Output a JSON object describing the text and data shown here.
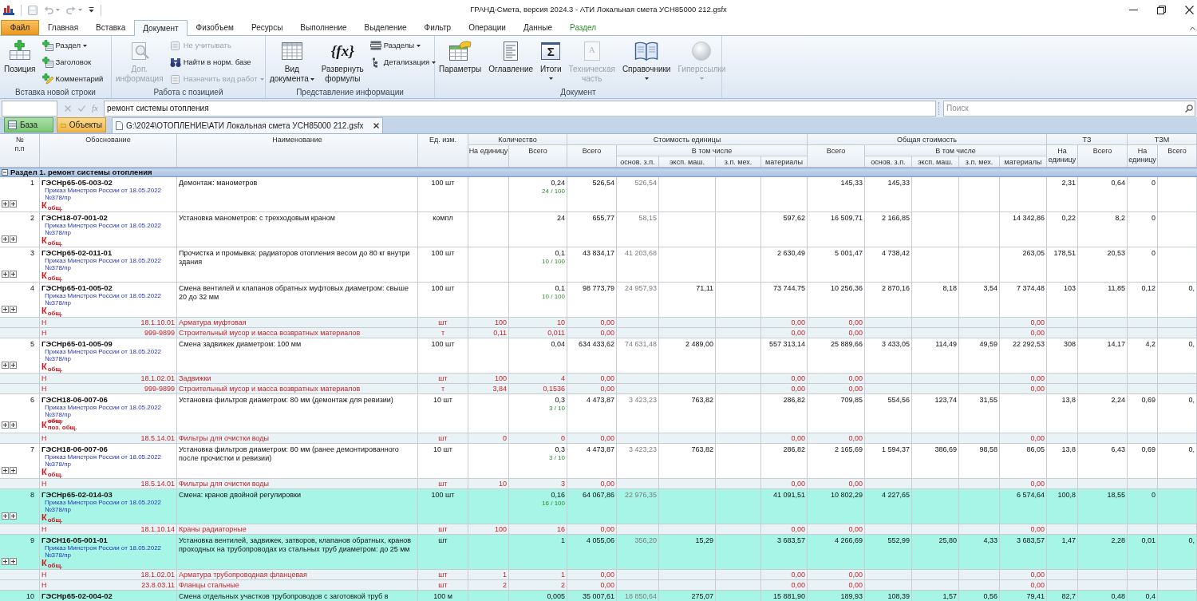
{
  "window": {
    "title": "ГРАНД-Смета, версия 2024.3 - АТИ Локальная смета УСН85000 212.gsfx"
  },
  "quick_access": [
    {
      "kind": "save",
      "disabled": true
    },
    {
      "kind": "undo",
      "disabled": true
    },
    {
      "kind": "redo",
      "disabled": true
    }
  ],
  "ribbon": {
    "tabs": [
      {
        "label": "Файл",
        "kind": "file",
        "selected": false
      },
      {
        "label": "Главная",
        "kind": "plain",
        "selected": false
      },
      {
        "label": "Вставка",
        "kind": "plain",
        "selected": false
      },
      {
        "label": "Документ",
        "kind": "plain",
        "selected": true
      },
      {
        "label": "Физобъем",
        "kind": "plain",
        "selected": false
      },
      {
        "label": "Ресурсы",
        "kind": "plain",
        "selected": false
      },
      {
        "label": "Выполнение",
        "kind": "plain",
        "selected": false
      },
      {
        "label": "Выделение",
        "kind": "plain",
        "selected": false
      },
      {
        "label": "Фильтр",
        "kind": "plain",
        "selected": false
      },
      {
        "label": "Операции",
        "kind": "plain",
        "selected": false
      },
      {
        "label": "Данные",
        "kind": "plain",
        "selected": false
      },
      {
        "label": "Раздел",
        "kind": "context",
        "selected": false
      }
    ],
    "groups": [
      {
        "label": "Вставка новой строки",
        "items": [
          {
            "kind": "large",
            "label": "Позиция",
            "disabled": false,
            "dropdown": false
          },
          {
            "kind": "small",
            "label": "Раздел",
            "disabled": false,
            "dropdown": true
          },
          {
            "kind": "small",
            "label": "Заголовок",
            "disabled": false,
            "dropdown": false
          },
          {
            "kind": "small",
            "label": "Комментарий",
            "disabled": false,
            "dropdown": false
          }
        ]
      },
      {
        "label": "Работа с позицией",
        "items": [
          {
            "kind": "large",
            "label": "Доп. информация",
            "disabled": true,
            "dropdown": false
          },
          {
            "kind": "small",
            "label": "Не учитывать",
            "disabled": true,
            "dropdown": false
          },
          {
            "kind": "small",
            "label": "Найти в норм. базе",
            "disabled": false,
            "dropdown": false
          },
          {
            "kind": "small",
            "label": "Назначить вид работ",
            "disabled": true,
            "dropdown": true
          }
        ]
      },
      {
        "label": "Представление информации",
        "items": [
          {
            "kind": "large",
            "label": "Вид документа",
            "disabled": false,
            "dropdown": true
          },
          {
            "kind": "large",
            "label": "Развернуть формулы",
            "disabled": false,
            "dropdown": false,
            "icon_text": "{fx}"
          },
          {
            "kind": "small",
            "label": "Разделы",
            "disabled": false,
            "dropdown": true
          },
          {
            "kind": "small",
            "label": "Детализация",
            "disabled": false,
            "dropdown": true
          }
        ]
      },
      {
        "label": "Документ",
        "items": [
          {
            "kind": "large",
            "label": "Параметры",
            "disabled": false,
            "dropdown": false
          },
          {
            "kind": "large",
            "label": "Оглавление",
            "disabled": false,
            "dropdown": false
          },
          {
            "kind": "large",
            "label": "Итоги",
            "disabled": false,
            "dropdown": true,
            "icon_text": "Σ"
          },
          {
            "kind": "large",
            "label": "Техническая часть",
            "disabled": true,
            "dropdown": false,
            "icon_text": "A"
          },
          {
            "kind": "large",
            "label": "Справочники",
            "disabled": false,
            "dropdown": true
          },
          {
            "kind": "large",
            "label": "Гиперссылки",
            "disabled": true,
            "dropdown": true
          }
        ]
      }
    ]
  },
  "formula_bar": {
    "function_label": "fx",
    "value": "ремонт системы отопления",
    "search": {
      "placeholder": "Поиск"
    }
  },
  "panels": [
    {
      "label": "База",
      "kind": "base"
    },
    {
      "label": "Объекты",
      "kind": "objects"
    }
  ],
  "documents": [
    {
      "label": "G:\\2024\\ОТОПЛЕНИЕ\\АТИ Локальная смета УСН85000 212.gsfx",
      "selected": true
    }
  ],
  "table": {
    "columns": [
      {
        "label": "№ п.п"
      },
      {
        "label": "Обоснование"
      },
      {
        "label": "Наименование"
      },
      {
        "label": "Ед. изм."
      },
      {
        "label": "Количество",
        "children": [
          {
            "label": "На единицу"
          },
          {
            "label": "Всего"
          }
        ]
      },
      {
        "label": "Стоимость единицы",
        "children": [
          {
            "label": "Всего"
          },
          {
            "label": "В том числе",
            "children": [
              {
                "label": "основ. з.п."
              },
              {
                "label": "эксп. маш."
              },
              {
                "label": "з.п. мех."
              },
              {
                "label": "материалы"
              }
            ]
          }
        ]
      },
      {
        "label": "Общая стоимость",
        "children": [
          {
            "label": "Всего"
          },
          {
            "label": "В том числе",
            "children": [
              {
                "label": "основ. з.п."
              },
              {
                "label": "эксп. маш."
              },
              {
                "label": "з.п. мех."
              },
              {
                "label": "материалы"
              }
            ]
          }
        ]
      },
      {
        "label": "ТЗ",
        "children": [
          {
            "label": "На единицу"
          },
          {
            "label": "Всего"
          }
        ]
      },
      {
        "label": "ТЗМ",
        "children": [
          {
            "label": "На единицу"
          },
          {
            "label": "Всего"
          }
        ]
      }
    ],
    "section": {
      "label": "Раздел 1. ремонт системы отопления",
      "expanded": true
    },
    "rows": [
      {
        "kind": "position",
        "selected": false,
        "number": "1",
        "code": "ГЭСНр65-05-003-02",
        "order": "Приказ Минстроя России от 18.05.2022",
        "order_number": "№378/пр",
        "coef": {
          "letter": "К",
          "labels": [
            {
              "text": "общ.",
              "struck": false
            }
          ]
        },
        "name": "Демонтаж: манометров",
        "unit": "100 шт",
        "qty_formula": "24 / 100",
        "values": {
          "qty_total": "0,24",
          "unit_cost": "526,54",
          "unit_base_wage": "526,54",
          "total_cost": "145,33",
          "total_base_wage": "145,33",
          "labor_per_unit": "2,31",
          "labor_total": "0,64",
          "machine_labor_per_unit": "0"
        }
      },
      {
        "kind": "position",
        "selected": false,
        "number": "2",
        "code": "ГЭСН18-07-001-02",
        "order": "Приказ Минстроя России от 18.05.2022",
        "order_number": "№378/пр",
        "coef": {
          "letter": "К",
          "labels": [
            {
              "text": "общ.",
              "struck": false
            }
          ]
        },
        "name": "Установка манометров: с трехходовым краном",
        "unit": "компл",
        "values": {
          "qty_total": "24",
          "unit_cost": "655,77",
          "unit_base_wage": "58,15",
          "unit_materials": "597,62",
          "total_cost": "16 509,71",
          "total_base_wage": "2 166,85",
          "total_materials": "14 342,86",
          "labor_per_unit": "0,22",
          "labor_total": "8,2",
          "machine_labor_per_unit": "0"
        }
      },
      {
        "kind": "position",
        "selected": false,
        "number": "3",
        "code": "ГЭСНр65-02-011-01",
        "order": "Приказ Минстроя России от 18.05.2022",
        "order_number": "№378/пр",
        "coef": {
          "letter": "К",
          "labels": [
            {
              "text": "общ.",
              "struck": false
            }
          ]
        },
        "name": "Прочистка и промывка: радиаторов отопления весом до 80 кг внутри здания",
        "unit": "100 шт",
        "qty_formula": "10 / 100",
        "values": {
          "qty_total": "0,1",
          "unit_cost": "43 834,17",
          "unit_base_wage": "41 203,68",
          "unit_materials": "2 630,49",
          "total_cost": "5 001,47",
          "total_base_wage": "4 738,42",
          "total_materials": "263,05",
          "labor_per_unit": "178,51",
          "labor_total": "20,53",
          "machine_labor_per_unit": "0"
        }
      },
      {
        "kind": "position",
        "selected": false,
        "number": "4",
        "code": "ГЭСНр65-01-005-02",
        "order": "Приказ Минстроя России от 18.05.2022",
        "order_number": "№378/пр",
        "coef": {
          "letter": "К",
          "labels": [
            {
              "text": "общ.",
              "struck": false
            }
          ]
        },
        "name": "Смена вентилей и клапанов обратных муфтовых диаметром: свыше 20 до 32 мм",
        "unit": "100 шт",
        "qty_formula": "10 / 100",
        "values": {
          "qty_total": "0,1",
          "unit_cost": "98 773,79",
          "unit_base_wage": "24 957,93",
          "unit_machines": "71,11",
          "unit_materials": "73 744,75",
          "total_cost": "10 256,36",
          "total_base_wage": "2 870,16",
          "total_machines": "8,18",
          "total_machinist_wage": "3,54",
          "total_materials": "7 374,48",
          "labor_per_unit": "103",
          "labor_total": "11,85",
          "machine_labor_per_unit": "0,12",
          "machine_labor_total": "0,"
        }
      },
      {
        "kind": "resource",
        "type": "Н",
        "code": "18.1.10.01",
        "name": "Арматура муфтовая",
        "unit": "шт",
        "values": {
          "qty_per_unit": "100",
          "qty_total": "10",
          "unit_cost": "0,00",
          "unit_materials": "0,00",
          "total_cost": "0,00",
          "total_materials": "0,00"
        }
      },
      {
        "kind": "resource",
        "type": "Н",
        "code": "999-9899",
        "name": "Строительный мусор и масса возвратных материалов",
        "unit": "т",
        "values": {
          "qty_per_unit": "0,11",
          "qty_total": "0,011",
          "unit_cost": "0,00",
          "unit_materials": "0,00",
          "total_cost": "0,00",
          "total_materials": "0,00"
        }
      },
      {
        "kind": "position",
        "selected": false,
        "number": "5",
        "code": "ГЭСНр65-01-005-09",
        "order": "Приказ Минстроя России от 18.05.2022",
        "order_number": "№378/пр",
        "coef": {
          "letter": "К",
          "labels": [
            {
              "text": "общ.",
              "struck": false
            }
          ]
        },
        "name": "Смена задвижек диаметром: 100 мм",
        "unit": "100 шт",
        "values": {
          "qty_total": "0,04",
          "unit_cost": "634 433,62",
          "unit_base_wage": "74 631,48",
          "unit_machines": "2 489,00",
          "unit_materials": "557 313,14",
          "total_cost": "25 889,66",
          "total_base_wage": "3 433,05",
          "total_machines": "114,49",
          "total_machinist_wage": "49,59",
          "total_materials": "22 292,53",
          "labor_per_unit": "308",
          "labor_total": "14,17",
          "machine_labor_per_unit": "4,2",
          "machine_labor_total": "0,"
        }
      },
      {
        "kind": "resource",
        "type": "Н",
        "code": "18.1.02.01",
        "name": "Задвижки",
        "unit": "шт",
        "values": {
          "qty_per_unit": "100",
          "qty_total": "4",
          "unit_cost": "0,00",
          "unit_materials": "0,00",
          "total_cost": "0,00",
          "total_materials": "0,00"
        }
      },
      {
        "kind": "resource",
        "type": "Н",
        "code": "999-9899",
        "name": "Строительный мусор и масса возвратных материалов",
        "unit": "т",
        "values": {
          "qty_per_unit": "3,84",
          "qty_total": "0,1536",
          "unit_cost": "0,00",
          "unit_materials": "0,00",
          "total_cost": "0,00",
          "total_materials": "0,00"
        }
      },
      {
        "kind": "position",
        "selected": false,
        "number": "6",
        "code": "ГЭСН18-06-007-06",
        "order": "Приказ Минстроя России от 18.05.2022",
        "order_number": "№378/пр",
        "coef": {
          "letter": "К",
          "labels": [
            {
              "text": "общ.",
              "struck": true
            },
            {
              "text": "поз. общ.",
              "struck": false
            }
          ]
        },
        "name": "Установка фильтров диаметром: 80 мм (демонтаж для ревизии)",
        "unit": "10 шт",
        "qty_formula": "3 / 10",
        "values": {
          "qty_total": "0,3",
          "unit_cost": "4 473,87",
          "unit_base_wage": "3 423,23",
          "unit_machines": "763,82",
          "unit_materials": "286,82",
          "total_cost": "709,85",
          "total_base_wage": "554,56",
          "total_machines": "123,74",
          "total_machinist_wage": "31,55",
          "labor_per_unit": "13,8",
          "labor_total": "2,24",
          "machine_labor_per_unit": "0,69",
          "machine_labor_total": "0,"
        }
      },
      {
        "kind": "resource",
        "type": "Н",
        "code": "18.5.14.01",
        "name": "Фильтры для очистки воды",
        "unit": "шт",
        "values": {
          "qty_per_unit": "0",
          "qty_total": "0",
          "unit_cost": "0,00",
          "unit_materials": "0,00",
          "total_cost": "0,00",
          "total_materials": "0,00"
        }
      },
      {
        "kind": "position",
        "selected": false,
        "number": "7",
        "code": "ГЭСН18-06-007-06",
        "order": "Приказ Минстроя России от 18.05.2022",
        "order_number": "№378/пр",
        "coef": {
          "letter": "К",
          "labels": [
            {
              "text": "общ.",
              "struck": false
            }
          ]
        },
        "name": "Установка фильтров диаметром: 80 мм (ранее демонтированного после прочистки и ревизии)",
        "unit": "10 шт",
        "qty_formula": "3 / 10",
        "values": {
          "qty_total": "0,3",
          "unit_cost": "4 473,87",
          "unit_base_wage": "3 423,23",
          "unit_machines": "763,82",
          "unit_materials": "286,82",
          "total_cost": "2 165,69",
          "total_base_wage": "1 594,37",
          "total_machines": "386,69",
          "total_machinist_wage": "98,58",
          "total_materials": "86,05",
          "labor_per_unit": "13,8",
          "labor_total": "6,43",
          "machine_labor_per_unit": "0,69",
          "machine_labor_total": "0,"
        }
      },
      {
        "kind": "resource",
        "type": "Н",
        "code": "18.5.14.01",
        "name": "Фильтры для очистки воды",
        "unit": "шт",
        "values": {
          "qty_per_unit": "10",
          "qty_total": "3",
          "unit_cost": "0,00",
          "unit_materials": "0,00",
          "total_cost": "0,00",
          "total_materials": "0,00"
        }
      },
      {
        "kind": "position",
        "selected": true,
        "number": "8",
        "code": "ГЭСНр65-02-014-03",
        "order": "Приказ Минстроя России от 18.05.2022",
        "order_number": "№378/пр",
        "coef": {
          "letter": "К",
          "labels": [
            {
              "text": "общ.",
              "struck": false
            }
          ]
        },
        "name": "Смена: кранов двойной регулировки",
        "unit": "100 шт",
        "qty_formula": "16 / 100",
        "values": {
          "qty_total": "0,16",
          "unit_cost": "64 067,86",
          "unit_base_wage": "22 976,35",
          "unit_materials": "41 091,51",
          "total_cost": "10 802,29",
          "total_base_wage": "4 227,65",
          "total_materials": "6 574,64",
          "labor_per_unit": "100,8",
          "labor_total": "18,55",
          "machine_labor_per_unit": "0"
        }
      },
      {
        "kind": "resource",
        "type": "Н",
        "code": "18.1.10.14",
        "name": "Краны радиаторные",
        "unit": "шт",
        "values": {
          "qty_per_unit": "100",
          "qty_total": "16",
          "unit_cost": "0,00",
          "unit_materials": "0,00",
          "total_cost": "0,00",
          "total_materials": "0,00"
        }
      },
      {
        "kind": "position",
        "selected": true,
        "number": "9",
        "code": "ГЭСН16-05-001-01",
        "order": "Приказ Минстроя России от 18.05.2022",
        "order_number": "№378/пр",
        "coef": {
          "letter": "К",
          "labels": [
            {
              "text": "общ.",
              "struck": false
            }
          ]
        },
        "name": "Установка вентилей, задвижек, затворов, клапанов обратных, кранов проходных на трубопроводах из стальных труб диаметром: до 25 мм",
        "unit": "шт",
        "values": {
          "qty_total": "1",
          "unit_cost": "4 055,06",
          "unit_base_wage": "356,20",
          "unit_machines": "15,29",
          "unit_materials": "3 683,57",
          "total_cost": "4 266,69",
          "total_base_wage": "552,99",
          "total_machines": "25,80",
          "total_machinist_wage": "4,33",
          "total_materials": "3 683,57",
          "labor_per_unit": "1,47",
          "labor_total": "2,28",
          "machine_labor_per_unit": "0,01",
          "machine_labor_total": "0,"
        }
      },
      {
        "kind": "resource",
        "type": "Н",
        "code": "18.1.02.01",
        "name": "Арматура трубопроводная фланцевая",
        "unit": "шт",
        "values": {
          "qty_per_unit": "1",
          "qty_total": "1",
          "unit_cost": "0,00",
          "unit_materials": "0,00",
          "total_cost": "0,00",
          "total_materials": "0,00"
        }
      },
      {
        "kind": "resource",
        "type": "Н",
        "code": "23.8.03.11",
        "name": "Фланцы стальные",
        "unit": "шт",
        "values": {
          "qty_per_unit": "2",
          "qty_total": "2",
          "unit_cost": "0,00",
          "unit_materials": "0,00",
          "total_cost": "0,00",
          "total_materials": "0,00"
        }
      },
      {
        "kind": "position",
        "selected": true,
        "number": "10",
        "code": "ГЭСНр65-02-004-02",
        "name": "Смена отдельных участков трубопроводов с заготовкой труб в",
        "unit": "100 м",
        "values": {
          "qty_total": "0,005",
          "unit_cost": "35 007,61",
          "unit_base_wage": "18 850,64",
          "unit_machines": "275,07",
          "unit_materials": "15 881,90",
          "total_cost": "189,93",
          "total_base_wage": "108,39",
          "total_machines": "1,57",
          "total_machinist_wage": "0,56",
          "total_materials": "79,41",
          "labor_per_unit": "82,7",
          "labor_total": "0,48",
          "machine_labor_per_unit": "0,4"
        }
      }
    ]
  }
}
